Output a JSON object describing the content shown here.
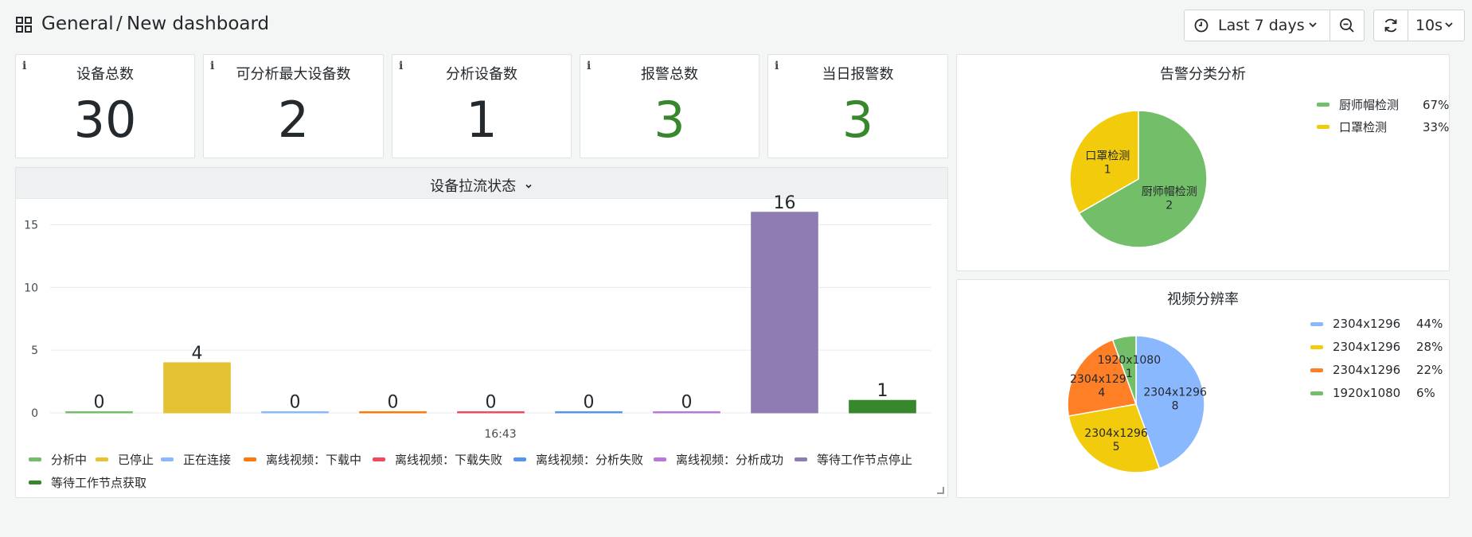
{
  "header": {
    "folder": "General",
    "separator": "/",
    "title": "New dashboard",
    "time_range": "Last 7 days",
    "refresh_interval": "10s"
  },
  "stats": [
    {
      "info": "i",
      "title": "设备总数",
      "value": "30",
      "color": "#24292e"
    },
    {
      "info": "i",
      "title": "可分析最大设备数",
      "value": "2",
      "color": "#24292e"
    },
    {
      "info": "i",
      "title": "分析设备数",
      "value": "1",
      "color": "#24292e"
    },
    {
      "info": "i",
      "title": "报警总数",
      "value": "3",
      "color": "#37872d"
    },
    {
      "info": "i",
      "title": "当日报警数",
      "value": "3",
      "color": "#37872d"
    }
  ],
  "bar_panel": {
    "title": "设备拉流状态",
    "x_tick": "16:43"
  },
  "alarm_panel": {
    "title": "告警分类分析"
  },
  "resolution_panel": {
    "title": "视频分辨率"
  },
  "chart_data": [
    {
      "type": "bar",
      "title": "设备拉流状态",
      "categories": [
        "16:43"
      ],
      "ylim": [
        0,
        17
      ],
      "yticks": [
        0,
        5,
        10,
        15
      ],
      "grid": true,
      "legend_placement": "bottom",
      "series": [
        {
          "name": "分析中",
          "values": [
            0
          ],
          "color": "#73bf69"
        },
        {
          "name": "已停止",
          "values": [
            4
          ],
          "color": "#e5c233"
        },
        {
          "name": "正在连接",
          "values": [
            0
          ],
          "color": "#8ab8ff"
        },
        {
          "name": "离线视频：下载中",
          "values": [
            0
          ],
          "color": "#ff780a"
        },
        {
          "name": "离线视频：下载失败",
          "values": [
            0
          ],
          "color": "#f2495c"
        },
        {
          "name": "离线视频：分析失败",
          "values": [
            0
          ],
          "color": "#5794f2"
        },
        {
          "name": "离线视频：分析成功",
          "values": [
            0
          ],
          "color": "#b877d9"
        },
        {
          "name": "等待工作节点停止",
          "values": [
            16
          ],
          "color": "#8f7cb2"
        },
        {
          "name": "等待工作节点获取",
          "values": [
            1
          ],
          "color": "#37872d"
        }
      ]
    },
    {
      "type": "pie",
      "title": "告警分类分析",
      "legend_placement": "right",
      "slices": [
        {
          "name": "厨师帽检测",
          "value": 2,
          "percent": "67%",
          "color": "#73bf69"
        },
        {
          "name": "口罩检测",
          "value": 1,
          "percent": "33%",
          "color": "#f2cc0c"
        }
      ]
    },
    {
      "type": "pie",
      "title": "视频分辨率",
      "legend_placement": "right",
      "slices": [
        {
          "name": "2304x1296",
          "value": 8,
          "percent": "44%",
          "color": "#8ab8ff"
        },
        {
          "name": "2304x1296",
          "value": 5,
          "percent": "28%",
          "color": "#f2cc0c"
        },
        {
          "name": "2304x1296",
          "value": 4,
          "percent": "22%",
          "color": "#ff7f27"
        },
        {
          "name": "1920x1080",
          "value": 1,
          "percent": "6%",
          "color": "#73bf69"
        }
      ]
    }
  ]
}
